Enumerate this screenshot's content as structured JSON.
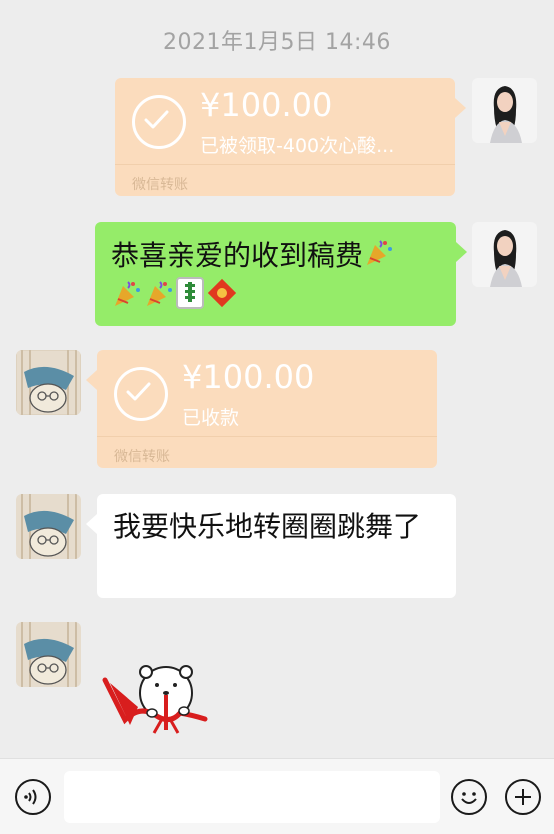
{
  "timestamp": "2021年1月5日 14:46",
  "messages": [
    {
      "type": "transfer",
      "side": "right",
      "amount": "¥100.00",
      "status": "已被领取-400次心酸...",
      "label": "微信转账"
    },
    {
      "type": "text",
      "side": "right",
      "text": "恭喜亲爱的收到稿费"
    },
    {
      "type": "transfer",
      "side": "left",
      "amount": "¥100.00",
      "status": "已收款",
      "label": "微信转账"
    },
    {
      "type": "text",
      "side": "left",
      "text": "我要快乐地转圈圈跳舞了"
    },
    {
      "type": "sticker",
      "side": "left",
      "sticker_name": "bear-with-ribbon-sticker"
    }
  ],
  "input_bar": {
    "voice_icon": "voice-icon",
    "emoji_icon": "emoji-face-icon",
    "plus_icon": "plus-icon"
  },
  "colors": {
    "background": "#ededed",
    "transfer_bubble": "#fbdcbd",
    "sent_bubble": "#95ec69",
    "received_bubble": "#ffffff"
  }
}
